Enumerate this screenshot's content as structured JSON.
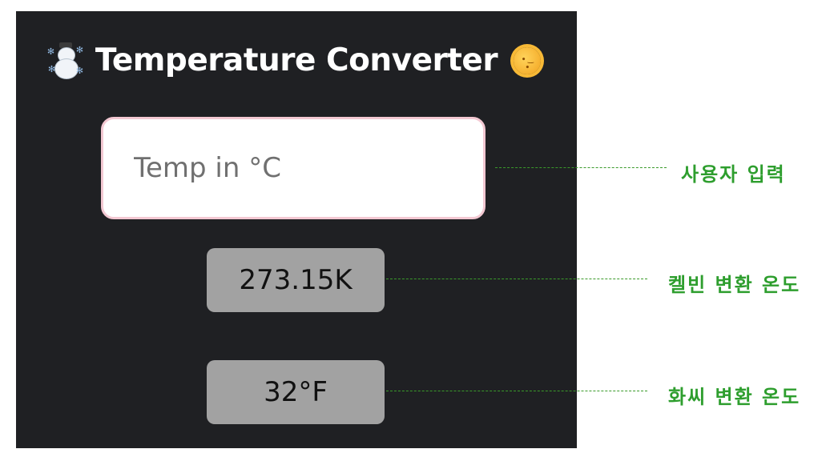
{
  "app": {
    "title": "Temperature Converter",
    "title_left_icon": "snowman-icon",
    "title_right_icon": "sun-icon"
  },
  "input": {
    "value": "",
    "placeholder": "Temp in °C"
  },
  "results": {
    "kelvin": "273.15K",
    "fahrenheit": "32°F"
  },
  "annotations": {
    "input_label": "사용자 입력",
    "kelvin_label": "켈빈 변환 온도",
    "fahrenheit_label": "화씨 변환 온도"
  },
  "colors": {
    "panel_bg": "#1f2023",
    "input_border": "#f3c8d2",
    "result_bg": "#a2a2a2",
    "annotation": "#2e9e2e"
  }
}
